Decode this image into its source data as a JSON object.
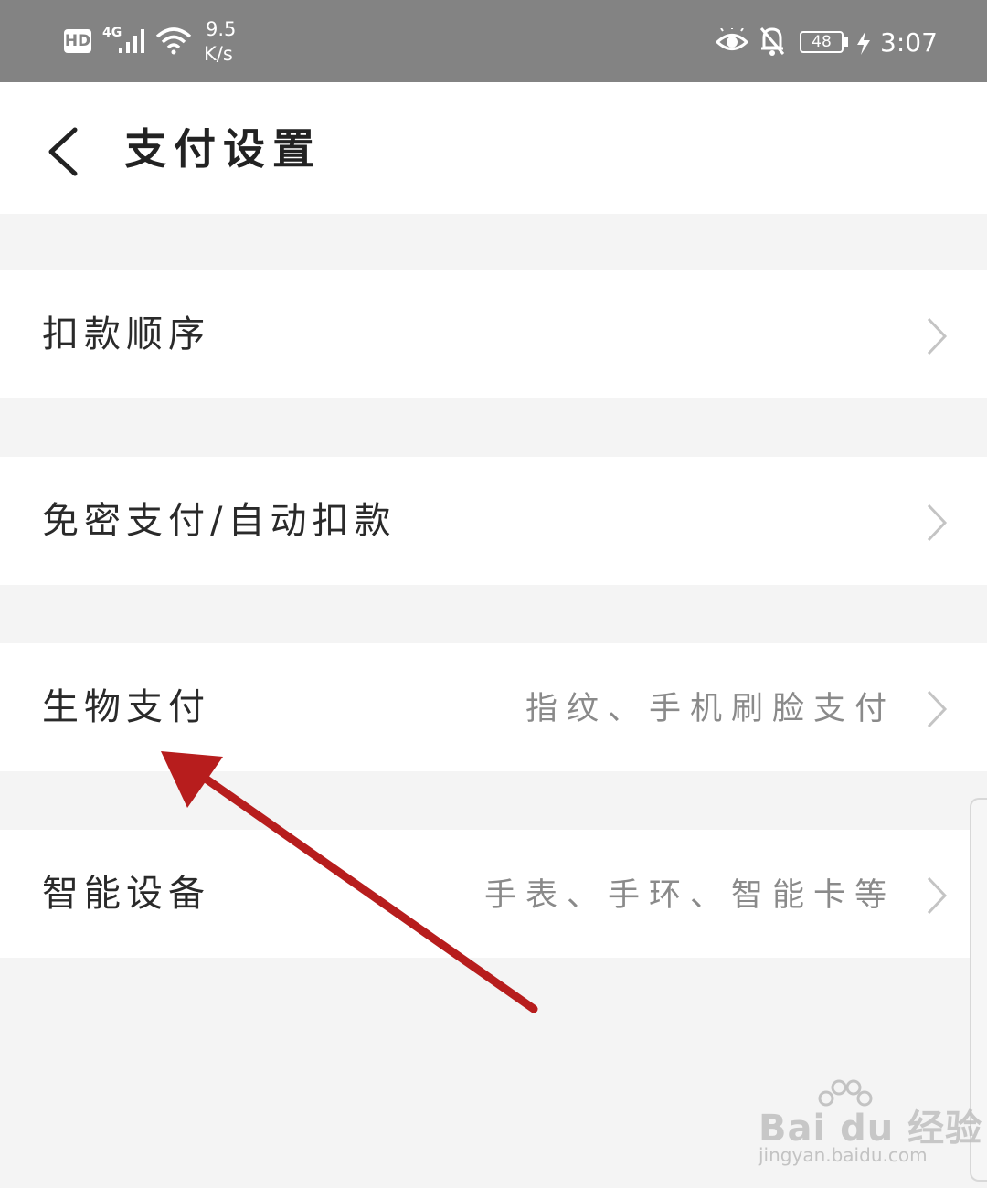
{
  "status_bar": {
    "hd": "HD",
    "network": "4G",
    "speed_value": "9.5",
    "speed_unit": "K/s",
    "battery": "48",
    "time": "3:07"
  },
  "header": {
    "title": "支付设置"
  },
  "menu": [
    {
      "label": "扣款顺序",
      "sub": ""
    },
    {
      "label": "免密支付/自动扣款",
      "sub": ""
    },
    {
      "label": "生物支付",
      "sub": "指纹、手机刷脸支付"
    },
    {
      "label": "智能设备",
      "sub": "手表、手环、智能卡等"
    }
  ],
  "watermark": {
    "logo": "Bai du 经验",
    "url": "jingyan.baidu.com"
  },
  "colors": {
    "status_bar": "#838383",
    "background": "#f4f4f4",
    "annotation_arrow": "#b71d1d"
  }
}
